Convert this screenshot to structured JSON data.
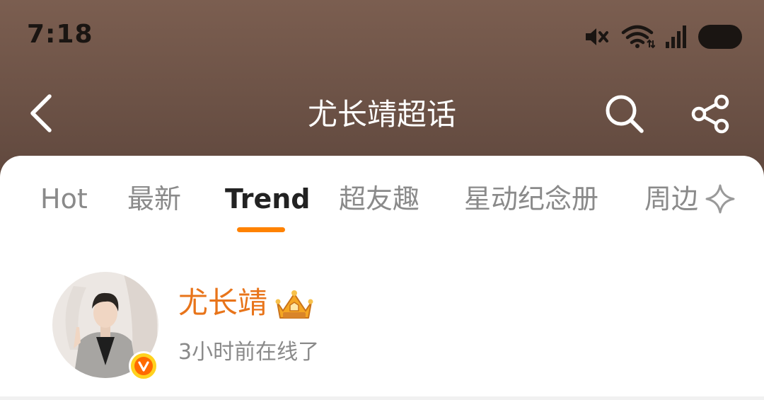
{
  "status_bar": {
    "time": "7:18",
    "icons": [
      "mute-icon",
      "wifi-icon",
      "signal-icon",
      "battery-icon"
    ]
  },
  "nav": {
    "title": "尤长靖超话",
    "icons": [
      "back-icon",
      "search-icon",
      "share-icon"
    ]
  },
  "tabs": {
    "items": [
      {
        "label": "Hot",
        "active": false
      },
      {
        "label": "最新",
        "active": false
      },
      {
        "label": "Trend",
        "active": true
      },
      {
        "label": "超友趣",
        "active": false
      },
      {
        "label": "星动纪念册",
        "active": false
      },
      {
        "label": "周边",
        "active": false
      }
    ],
    "extra_icon": "sparkle-icon"
  },
  "profile": {
    "name": "尤长靖",
    "status": "3小时前在线了",
    "badge": "V"
  },
  "colors": {
    "header_bg": "#6c5246",
    "accent": "#ff8200",
    "name": "#e8741a",
    "verified": "#ffd21e"
  }
}
